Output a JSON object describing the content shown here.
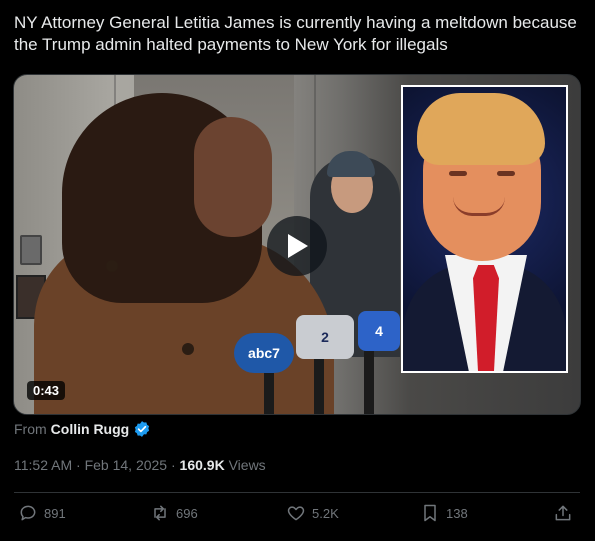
{
  "tweet": {
    "text": "NY Attorney General Letitia James is currently having a meltdown because the Trump admin halted payments to New York for illegals"
  },
  "media": {
    "duration": "0:43",
    "mic_labels": [
      "abc7",
      "2",
      "4"
    ]
  },
  "attribution": {
    "from_label": "From",
    "author": "Collin Rugg"
  },
  "meta": {
    "time": "11:52 AM",
    "separator": "·",
    "date": "Feb 14, 2025",
    "views_count": "160.9K",
    "views_label": "Views"
  },
  "actions": {
    "replies": "891",
    "reposts": "696",
    "likes": "5.2K",
    "bookmarks": "138"
  },
  "icons": {
    "verified": "verified-badge-icon",
    "play": "play-icon",
    "reply": "reply-icon",
    "repost": "repost-icon",
    "like": "heart-icon",
    "bookmark": "bookmark-icon",
    "share": "share-icon"
  },
  "colors": {
    "background": "#000000",
    "text": "#e7e9ea",
    "muted": "#71767b",
    "verified": "#1d9bf0",
    "divider": "#2f3336"
  }
}
